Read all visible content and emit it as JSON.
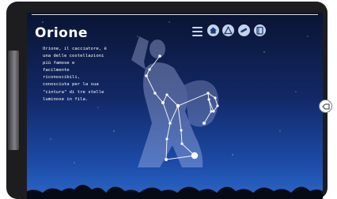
{
  "app": {
    "title": "Orione",
    "description": "Orione, il cacciatore, è\nuna delle costellazioni\npiù famose e\nfacilmente\nriconoscibili,\nconosciuta per la sua\n\"cintura\" di tre stelle\nluminose in fila."
  },
  "toolbar": {
    "icons": [
      "menu-icon",
      "home-icon",
      "triangle-icon",
      "telescope-icon",
      "book-icon"
    ]
  },
  "device": {
    "side_button_icon": "back-icon"
  },
  "colors": {
    "sky_top": "#0a1432",
    "sky_bottom": "#2a68c8",
    "toolbar_icon": "#c5d3ea",
    "figure": "#c8d4ff"
  }
}
